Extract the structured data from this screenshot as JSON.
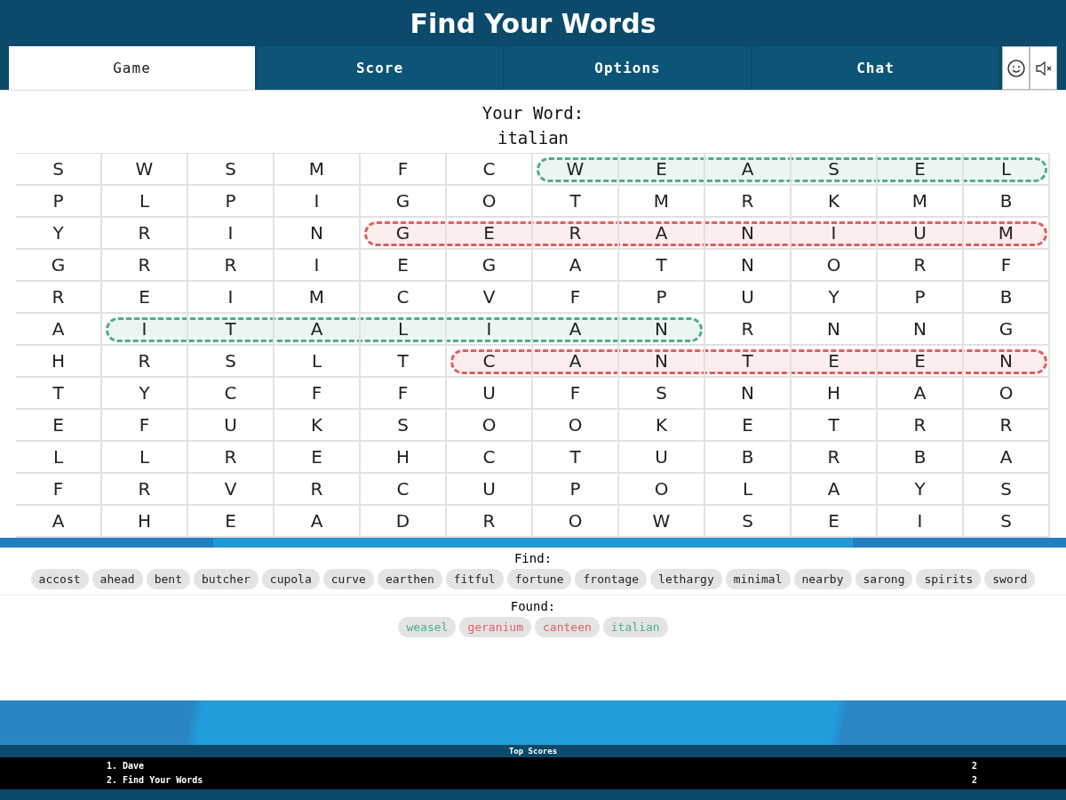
{
  "title": "Find Your Words",
  "tabs": [
    {
      "label": "Game",
      "selected": true
    },
    {
      "label": "Score",
      "selected": false
    },
    {
      "label": "Options",
      "selected": false
    },
    {
      "label": "Chat",
      "selected": false
    }
  ],
  "your_word": {
    "label": "Your Word:",
    "value": "italian"
  },
  "grid": [
    {
      "cells": [
        {
          "letter": "S",
          "marked": false
        },
        {
          "letter": "W",
          "marked": false
        },
        {
          "letter": "S",
          "marked": false
        },
        {
          "letter": "M",
          "marked": false
        },
        {
          "letter": "F",
          "marked": false
        },
        {
          "letter": "C",
          "marked": false
        },
        {
          "letter": "W",
          "marked": true
        },
        {
          "letter": "E",
          "marked": true
        },
        {
          "letter": "A",
          "marked": true
        },
        {
          "letter": "S",
          "marked": true
        },
        {
          "letter": "E",
          "marked": true
        },
        {
          "letter": "L",
          "marked": true
        }
      ],
      "color": "#4caf8a"
    },
    {
      "cells": [
        {
          "letter": "P",
          "marked": false
        },
        {
          "letter": "L",
          "marked": false
        },
        {
          "letter": "P",
          "marked": false
        },
        {
          "letter": "I",
          "marked": false
        },
        {
          "letter": "G",
          "marked": false
        },
        {
          "letter": "O",
          "marked": false
        },
        {
          "letter": "T",
          "marked": false
        },
        {
          "letter": "M",
          "marked": false
        },
        {
          "letter": "R",
          "marked": false
        },
        {
          "letter": "K",
          "marked": false
        },
        {
          "letter": "M",
          "marked": false
        },
        {
          "letter": "B",
          "marked": false
        }
      ]
    },
    {
      "cells": [
        {
          "letter": "Y",
          "marked": false
        },
        {
          "letter": "R",
          "marked": false
        },
        {
          "letter": "I",
          "marked": false
        },
        {
          "letter": "N",
          "marked": false
        },
        {
          "letter": "G",
          "marked": true
        },
        {
          "letter": "E",
          "marked": true
        },
        {
          "letter": "R",
          "marked": true
        },
        {
          "letter": "A",
          "marked": true
        },
        {
          "letter": "N",
          "marked": true
        },
        {
          "letter": "I",
          "marked": true
        },
        {
          "letter": "U",
          "marked": true
        },
        {
          "letter": "M",
          "marked": true
        }
      ],
      "color": "#e06060"
    },
    {
      "cells": [
        {
          "letter": "G",
          "marked": false
        },
        {
          "letter": "R",
          "marked": false
        },
        {
          "letter": "R",
          "marked": false
        },
        {
          "letter": "I",
          "marked": false
        },
        {
          "letter": "E",
          "marked": false
        },
        {
          "letter": "G",
          "marked": false
        },
        {
          "letter": "A",
          "marked": false
        },
        {
          "letter": "T",
          "marked": false
        },
        {
          "letter": "N",
          "marked": false
        },
        {
          "letter": "O",
          "marked": false
        },
        {
          "letter": "R",
          "marked": false
        },
        {
          "letter": "F",
          "marked": false
        }
      ]
    },
    {
      "cells": [
        {
          "letter": "R",
          "marked": false
        },
        {
          "letter": "E",
          "marked": false
        },
        {
          "letter": "I",
          "marked": false
        },
        {
          "letter": "M",
          "marked": false
        },
        {
          "letter": "C",
          "marked": false
        },
        {
          "letter": "V",
          "marked": false
        },
        {
          "letter": "F",
          "marked": false
        },
        {
          "letter": "P",
          "marked": false
        },
        {
          "letter": "U",
          "marked": false
        },
        {
          "letter": "Y",
          "marked": false
        },
        {
          "letter": "P",
          "marked": false
        },
        {
          "letter": "B",
          "marked": false
        }
      ]
    },
    {
      "cells": [
        {
          "letter": "A",
          "marked": false
        },
        {
          "letter": "I",
          "marked": true
        },
        {
          "letter": "T",
          "marked": true
        },
        {
          "letter": "A",
          "marked": true
        },
        {
          "letter": "L",
          "marked": true
        },
        {
          "letter": "I",
          "marked": true
        },
        {
          "letter": "A",
          "marked": true
        },
        {
          "letter": "N",
          "marked": true
        },
        {
          "letter": "R",
          "marked": false
        },
        {
          "letter": "N",
          "marked": false
        },
        {
          "letter": "N",
          "marked": false
        },
        {
          "letter": "G",
          "marked": false
        }
      ],
      "color": "#4caf8a"
    },
    {
      "cells": [
        {
          "letter": "H",
          "marked": false
        },
        {
          "letter": "R",
          "marked": false
        },
        {
          "letter": "S",
          "marked": false
        },
        {
          "letter": "L",
          "marked": false
        },
        {
          "letter": "T",
          "marked": false
        },
        {
          "letter": "C",
          "marked": true
        },
        {
          "letter": "A",
          "marked": true
        },
        {
          "letter": "N",
          "marked": true
        },
        {
          "letter": "T",
          "marked": true
        },
        {
          "letter": "E",
          "marked": true
        },
        {
          "letter": "E",
          "marked": true
        },
        {
          "letter": "N",
          "marked": true
        }
      ],
      "color": "#e06060"
    },
    {
      "cells": [
        {
          "letter": "T",
          "marked": false
        },
        {
          "letter": "Y",
          "marked": false
        },
        {
          "letter": "C",
          "marked": false
        },
        {
          "letter": "F",
          "marked": false
        },
        {
          "letter": "F",
          "marked": false
        },
        {
          "letter": "U",
          "marked": false
        },
        {
          "letter": "F",
          "marked": false
        },
        {
          "letter": "S",
          "marked": false
        },
        {
          "letter": "N",
          "marked": false
        },
        {
          "letter": "H",
          "marked": false
        },
        {
          "letter": "A",
          "marked": false
        },
        {
          "letter": "O",
          "marked": false
        }
      ]
    },
    {
      "cells": [
        {
          "letter": "E",
          "marked": false
        },
        {
          "letter": "F",
          "marked": false
        },
        {
          "letter": "U",
          "marked": false
        },
        {
          "letter": "K",
          "marked": false
        },
        {
          "letter": "S",
          "marked": false
        },
        {
          "letter": "O",
          "marked": false
        },
        {
          "letter": "O",
          "marked": false
        },
        {
          "letter": "K",
          "marked": false
        },
        {
          "letter": "E",
          "marked": false
        },
        {
          "letter": "T",
          "marked": false
        },
        {
          "letter": "R",
          "marked": false
        },
        {
          "letter": "R",
          "marked": false
        }
      ]
    },
    {
      "cells": [
        {
          "letter": "L",
          "marked": false
        },
        {
          "letter": "L",
          "marked": false
        },
        {
          "letter": "R",
          "marked": false
        },
        {
          "letter": "E",
          "marked": false
        },
        {
          "letter": "H",
          "marked": false
        },
        {
          "letter": "C",
          "marked": false
        },
        {
          "letter": "T",
          "marked": false
        },
        {
          "letter": "U",
          "marked": false
        },
        {
          "letter": "B",
          "marked": false
        },
        {
          "letter": "R",
          "marked": false
        },
        {
          "letter": "B",
          "marked": false
        },
        {
          "letter": "A",
          "marked": false
        }
      ]
    },
    {
      "cells": [
        {
          "letter": "F",
          "marked": false
        },
        {
          "letter": "R",
          "marked": false
        },
        {
          "letter": "V",
          "marked": false
        },
        {
          "letter": "R",
          "marked": false
        },
        {
          "letter": "C",
          "marked": false
        },
        {
          "letter": "U",
          "marked": false
        },
        {
          "letter": "P",
          "marked": false
        },
        {
          "letter": "O",
          "marked": false
        },
        {
          "letter": "L",
          "marked": false
        },
        {
          "letter": "A",
          "marked": false
        },
        {
          "letter": "Y",
          "marked": false
        },
        {
          "letter": "S",
          "marked": false
        }
      ]
    },
    {
      "cells": [
        {
          "letter": "A",
          "marked": false
        },
        {
          "letter": "H",
          "marked": false
        },
        {
          "letter": "E",
          "marked": false
        },
        {
          "letter": "A",
          "marked": false
        },
        {
          "letter": "D",
          "marked": false
        },
        {
          "letter": "R",
          "marked": false
        },
        {
          "letter": "O",
          "marked": false
        },
        {
          "letter": "W",
          "marked": false
        },
        {
          "letter": "S",
          "marked": false
        },
        {
          "letter": "E",
          "marked": false
        },
        {
          "letter": "I",
          "marked": false
        },
        {
          "letter": "S",
          "marked": false
        }
      ]
    }
  ],
  "find": {
    "label": "Find:",
    "words": [
      "accost",
      "ahead",
      "bent",
      "butcher",
      "cupola",
      "curve",
      "earthen",
      "fitful",
      "fortune",
      "frontage",
      "lethargy",
      "minimal",
      "nearby",
      "sarong",
      "spirits",
      "sword"
    ]
  },
  "found": {
    "label": "Found:",
    "words": [
      {
        "text": "weasel",
        "color": "#4caf8a"
      },
      {
        "text": "geranium",
        "color": "#e06060"
      },
      {
        "text": "canteen",
        "color": "#e06060"
      },
      {
        "text": "italian",
        "color": "#4caf8a"
      }
    ]
  },
  "top_scores": {
    "title": "Top Scores",
    "rows": [
      {
        "name": "1. Dave",
        "score": "2"
      },
      {
        "name": "2. Find Your Words",
        "score": "2"
      }
    ]
  }
}
